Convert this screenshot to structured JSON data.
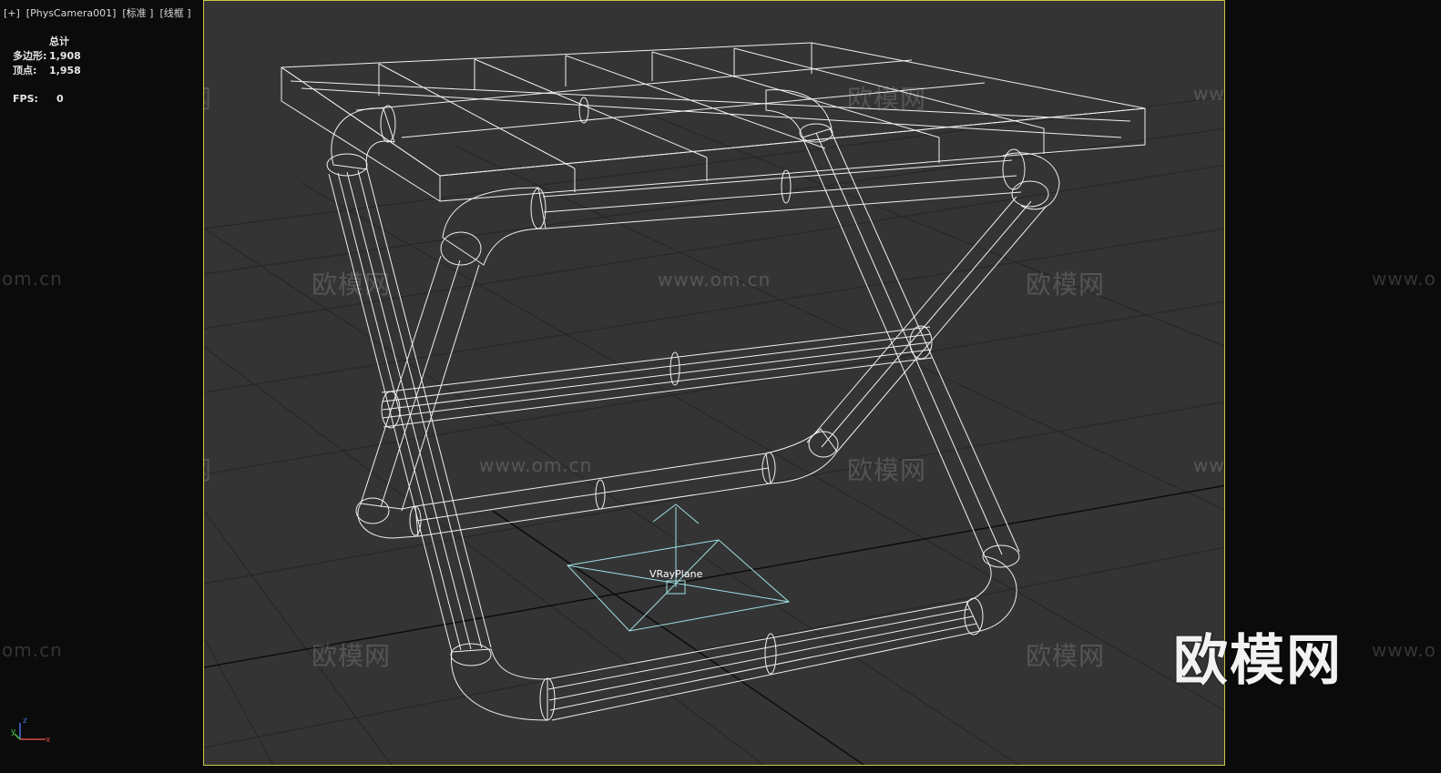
{
  "viewport": {
    "label": "[+]  [PhysCamera001]  [标准 ]  [线框 ]"
  },
  "stats": {
    "header": "总计",
    "polys_label": "多边形:",
    "polys_value": "1,908",
    "verts_label": "顶点:",
    "verts_value": "1,958",
    "fps_label": "FPS:",
    "fps_value": "0"
  },
  "scene": {
    "object_label": "VRayPlane",
    "wire_color": "#ffffff",
    "helper_color": "#9fe0e6",
    "grid_color": "#262626",
    "background": "#343434",
    "selection_border": "#c8c84a"
  },
  "watermarks": {
    "text_cn": "欧模网",
    "text_url": "www.om.cn",
    "fragment_url": "om.cn",
    "fragment_url_left": "www.o"
  },
  "logo": {
    "text": "欧模网"
  },
  "axis": {
    "x": "x",
    "y": "y",
    "z": "z"
  }
}
